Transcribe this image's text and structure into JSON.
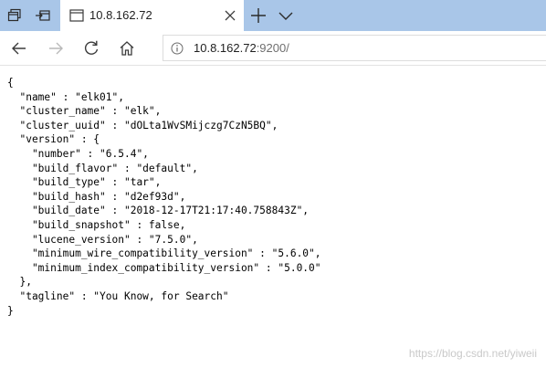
{
  "tab": {
    "title": "10.8.162.72"
  },
  "address": {
    "host": "10.8.162.72",
    "rest": ":9200/"
  },
  "response": {
    "lines": [
      "{",
      "  \"name\" : \"elk01\",",
      "  \"cluster_name\" : \"elk\",",
      "  \"cluster_uuid\" : \"dOLta1WvSMijczg7CzN5BQ\",",
      "  \"version\" : {",
      "    \"number\" : \"6.5.4\",",
      "    \"build_flavor\" : \"default\",",
      "    \"build_type\" : \"tar\",",
      "    \"build_hash\" : \"d2ef93d\",",
      "    \"build_date\" : \"2018-12-17T21:17:40.758843Z\",",
      "    \"build_snapshot\" : false,",
      "    \"lucene_version\" : \"7.5.0\",",
      "    \"minimum_wire_compatibility_version\" : \"5.6.0\",",
      "    \"minimum_index_compatibility_version\" : \"5.0.0\"",
      "  },",
      "  \"tagline\" : \"You Know, for Search\"",
      "}"
    ]
  },
  "watermark": "https://blog.csdn.net/yiweii",
  "icons": {
    "tab_actions": "tab-actions-icon",
    "set_aside_tabs": "set-aside-tabs-icon",
    "page": "page-icon",
    "close": "close-icon",
    "new_tab": "plus-icon",
    "tab_menu": "chevron-down-icon",
    "back": "arrow-left-icon",
    "forward": "arrow-right-icon",
    "refresh": "refresh-icon",
    "home": "home-icon",
    "info": "info-icon"
  },
  "colors": {
    "tabstrip": "#a9c6e8",
    "icon": "#3b3b3b",
    "disabled_icon": "#b9b9b9"
  }
}
